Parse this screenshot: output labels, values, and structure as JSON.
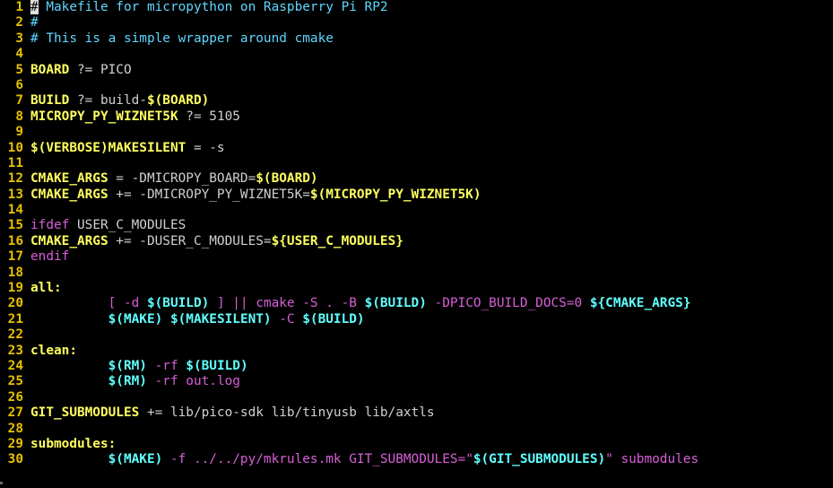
{
  "editor": {
    "colors": {
      "background": "#000000",
      "line_number": "#e5c100",
      "comment": "#5fd7ff",
      "variable": "#ffff5f",
      "reference": "#5fffff",
      "keyword": "#d75fd7",
      "text": "#d0d0d0"
    },
    "lines": [
      {
        "n": "1",
        "tokens": [
          {
            "t": "#",
            "c": "cursor"
          },
          {
            "t": " Makefile for micropython on Raspberry Pi RP2",
            "c": "comment"
          }
        ]
      },
      {
        "n": "2",
        "tokens": [
          {
            "t": "#",
            "c": "comment"
          }
        ]
      },
      {
        "n": "3",
        "tokens": [
          {
            "t": "# This is a simple wrapper around cmake",
            "c": "comment"
          }
        ]
      },
      {
        "n": "4",
        "tokens": []
      },
      {
        "n": "5",
        "tokens": [
          {
            "t": "BOARD",
            "c": "var"
          },
          {
            "t": " ?= PICO",
            "c": "text"
          }
        ]
      },
      {
        "n": "6",
        "tokens": []
      },
      {
        "n": "7",
        "tokens": [
          {
            "t": "BUILD",
            "c": "var"
          },
          {
            "t": " ?= build-",
            "c": "text"
          },
          {
            "t": "$(BOARD)",
            "c": "var"
          }
        ]
      },
      {
        "n": "8",
        "tokens": [
          {
            "t": "MICROPY_PY_WIZNET5K",
            "c": "var"
          },
          {
            "t": " ?= 5105",
            "c": "text"
          }
        ]
      },
      {
        "n": "9",
        "tokens": []
      },
      {
        "n": "10",
        "tokens": [
          {
            "t": "$(VERBOSE)MAKESILENT",
            "c": "var"
          },
          {
            "t": " = -s",
            "c": "text"
          }
        ]
      },
      {
        "n": "11",
        "tokens": []
      },
      {
        "n": "12",
        "tokens": [
          {
            "t": "CMAKE_ARGS",
            "c": "var"
          },
          {
            "t": " = -DMICROPY_BOARD=",
            "c": "text"
          },
          {
            "t": "$(BOARD)",
            "c": "var"
          }
        ]
      },
      {
        "n": "13",
        "tokens": [
          {
            "t": "CMAKE_ARGS",
            "c": "var"
          },
          {
            "t": " += -DMICROPY_PY_WIZNET5K=",
            "c": "text"
          },
          {
            "t": "$(MICROPY_PY_WIZNET5K)",
            "c": "var"
          }
        ]
      },
      {
        "n": "14",
        "tokens": []
      },
      {
        "n": "15",
        "tokens": [
          {
            "t": "ifdef",
            "c": "keyword"
          },
          {
            "t": " USER_C_MODULES",
            "c": "text"
          }
        ]
      },
      {
        "n": "16",
        "tokens": [
          {
            "t": "CMAKE_ARGS",
            "c": "var"
          },
          {
            "t": " += -DUSER_C_MODULES=",
            "c": "text"
          },
          {
            "t": "${USER_C_MODULES}",
            "c": "var"
          }
        ]
      },
      {
        "n": "17",
        "tokens": [
          {
            "t": "endif",
            "c": "keyword"
          }
        ]
      },
      {
        "n": "18",
        "tokens": []
      },
      {
        "n": "19",
        "tokens": [
          {
            "t": "all:",
            "c": "target"
          }
        ]
      },
      {
        "n": "20",
        "tokens": [
          {
            "t": "          ",
            "c": "text"
          },
          {
            "t": "[ -d ",
            "c": "keyword"
          },
          {
            "t": "$(BUILD)",
            "c": "ref"
          },
          {
            "t": " ] || cmake -S . -B ",
            "c": "keyword"
          },
          {
            "t": "$(BUILD)",
            "c": "ref"
          },
          {
            "t": " -DPICO_BUILD_DOCS=0 ",
            "c": "keyword"
          },
          {
            "t": "${CMAKE_ARGS}",
            "c": "ref"
          }
        ]
      },
      {
        "n": "21",
        "tokens": [
          {
            "t": "          ",
            "c": "text"
          },
          {
            "t": "$(MAKE)",
            "c": "ref"
          },
          {
            "t": " ",
            "c": "text"
          },
          {
            "t": "$(MAKESILENT)",
            "c": "ref"
          },
          {
            "t": " -C ",
            "c": "keyword"
          },
          {
            "t": "$(BUILD)",
            "c": "ref"
          }
        ]
      },
      {
        "n": "22",
        "tokens": []
      },
      {
        "n": "23",
        "tokens": [
          {
            "t": "clean:",
            "c": "target"
          }
        ]
      },
      {
        "n": "24",
        "tokens": [
          {
            "t": "          ",
            "c": "text"
          },
          {
            "t": "$(RM)",
            "c": "ref"
          },
          {
            "t": " -rf ",
            "c": "keyword"
          },
          {
            "t": "$(BUILD)",
            "c": "ref"
          }
        ]
      },
      {
        "n": "25",
        "tokens": [
          {
            "t": "          ",
            "c": "text"
          },
          {
            "t": "$(RM)",
            "c": "ref"
          },
          {
            "t": " -rf out.log",
            "c": "keyword"
          }
        ]
      },
      {
        "n": "26",
        "tokens": []
      },
      {
        "n": "27",
        "tokens": [
          {
            "t": "GIT_SUBMODULES",
            "c": "var"
          },
          {
            "t": " += lib/pico-sdk lib/tinyusb lib/axtls",
            "c": "text"
          }
        ]
      },
      {
        "n": "28",
        "tokens": []
      },
      {
        "n": "29",
        "tokens": [
          {
            "t": "submodules:",
            "c": "target"
          }
        ]
      },
      {
        "n": "30",
        "tokens": [
          {
            "t": "          ",
            "c": "text"
          },
          {
            "t": "$(MAKE)",
            "c": "ref"
          },
          {
            "t": " -f ../../py/mkrules.mk GIT_SUBMODULES=\"",
            "c": "keyword"
          },
          {
            "t": "$(GIT_SUBMODULES)",
            "c": "ref"
          },
          {
            "t": "\" submodules",
            "c": "keyword"
          }
        ]
      }
    ]
  }
}
